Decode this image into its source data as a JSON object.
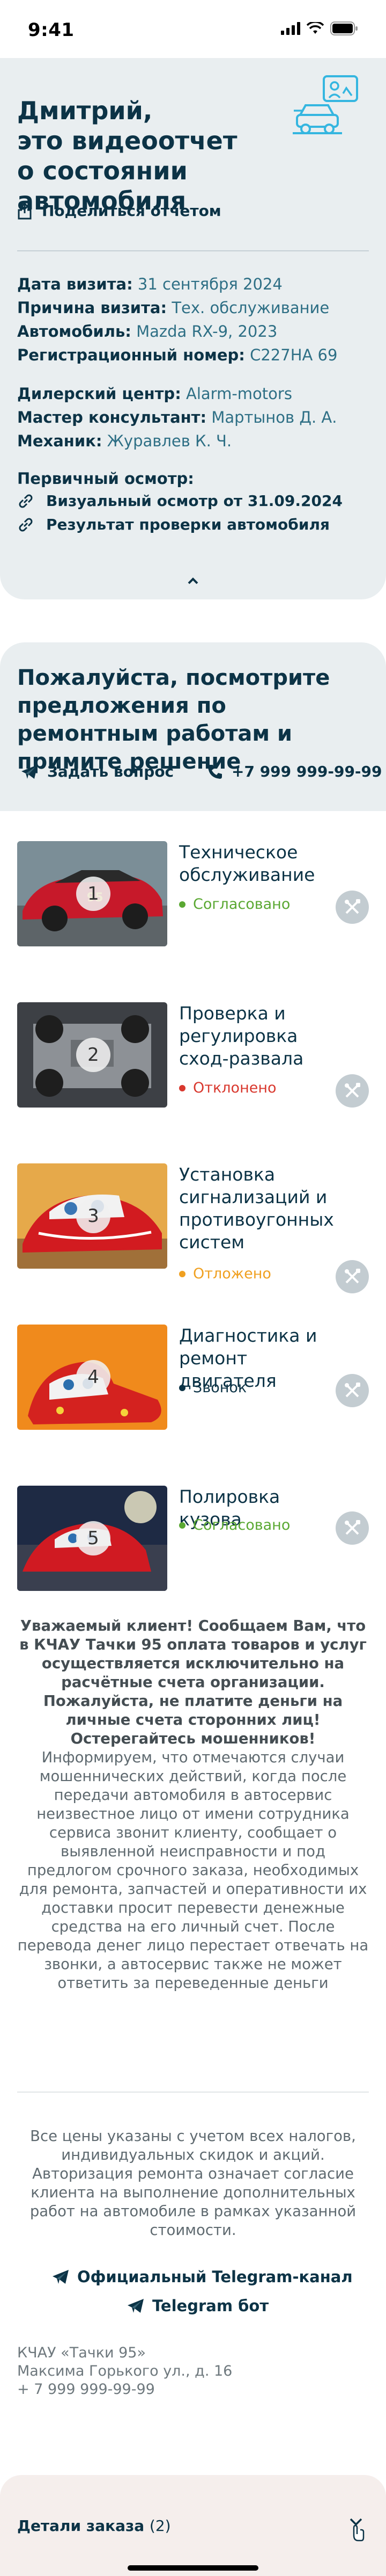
{
  "status_bar": {
    "time": "9:41"
  },
  "header": {
    "name_line": "Дмитрий,",
    "title_line2": "это видеоотчет",
    "title_line3": "о состоянии автомобиля",
    "share_label": "Поделиться отчетом"
  },
  "visit": {
    "date_label": "Дата визита:",
    "date_value": "31 сентября 2024",
    "reason_label": "Причина визита:",
    "reason_value": "Тех. обслуживание",
    "car_label": "Автомобиль:",
    "car_value": "Mazda RX-9, 2023",
    "reg_label": "Регистрационный номер:",
    "reg_value": "С227НА 69",
    "dealer_label": "Дилерский центр:",
    "dealer_value": "Alarm-motors",
    "master_label": "Мастер консультант:",
    "master_value": "Мартынов Д. А.",
    "mechanic_label": "Механик:",
    "mechanic_value": "Журавлев К. Ч.",
    "inspection_label": "Первичный осмотр:",
    "link1": "Визуальный осмотр от 31.09.2024",
    "link2": "Результат проверки автомобиля"
  },
  "proposals": {
    "title": "Пожалуйста, посмотрите предложения по ремонтным работам и примите решение",
    "ask_label": "Задать вопрос",
    "phone": "+7 999 999-99-99"
  },
  "items": [
    {
      "num": "1",
      "name": "Техническое обслуживание",
      "status": "Согласовано",
      "status_color": "#5aa832"
    },
    {
      "num": "2",
      "name": "Проверка и регулировка сход-развала",
      "status": "Отклонено",
      "status_color": "#d9382e"
    },
    {
      "num": "3",
      "name": "Установка сигнализаций и противоугонных систем",
      "status": "Отложено",
      "status_color": "#f0a020"
    },
    {
      "num": "4",
      "name": "Диагностика и ремонт двигателя",
      "status": "Звонок",
      "status_color": "#0c3346"
    },
    {
      "num": "5",
      "name": "Полировка кузова",
      "status": "Согласовано",
      "status_color": "#5aa832"
    }
  ],
  "warning": {
    "bold": "Уважаемый клиент! Сообщаем Вам, что в КЧАУ Тачки 95 оплата товаров и услуг осуществляется исключительно на расчётные счета организации. Пожалуйста, не платите деньги на личные счета сторонних лиц! Остерегайтесь мошенников!",
    "text": "Информируем, что отмечаются случаи мошеннических действий, когда после передачи автомобиля в автосервис неизвестное лицо от имени сотрудника сервиса звонит клиенту, сообщает о выявленной неисправности и под предлогом срочного заказа, необходимых для ремонта, запчастей и оперативности их доставки просит перевести денежные средства на его личный счет. После перевода денег лицо перестает отвечать на звонки, а автосервис также не может ответить за переведенные деньги"
  },
  "footer": {
    "prices": "Все цены указаны с учетом всех налогов, индивидуальных скидок и акций. Авторизация ремонта означает согласие клиента на выполнение дополнительных работ на автомобиле в рамках указанной стоимости.",
    "tg_channel": "Официальный  Telegram-канал",
    "tg_bot": "Telegram бот",
    "company": "КЧАУ «Тачки 95»",
    "address": "Максима Горького ул., д. 16",
    "phone": "+ 7 999 999-99-99"
  },
  "bottom_bar": {
    "label": "Детали заказа",
    "count": "(2)"
  },
  "colors": {
    "primary": "#0c3346",
    "accent": "#35b6e0",
    "card_bg": "#e9eef0"
  }
}
